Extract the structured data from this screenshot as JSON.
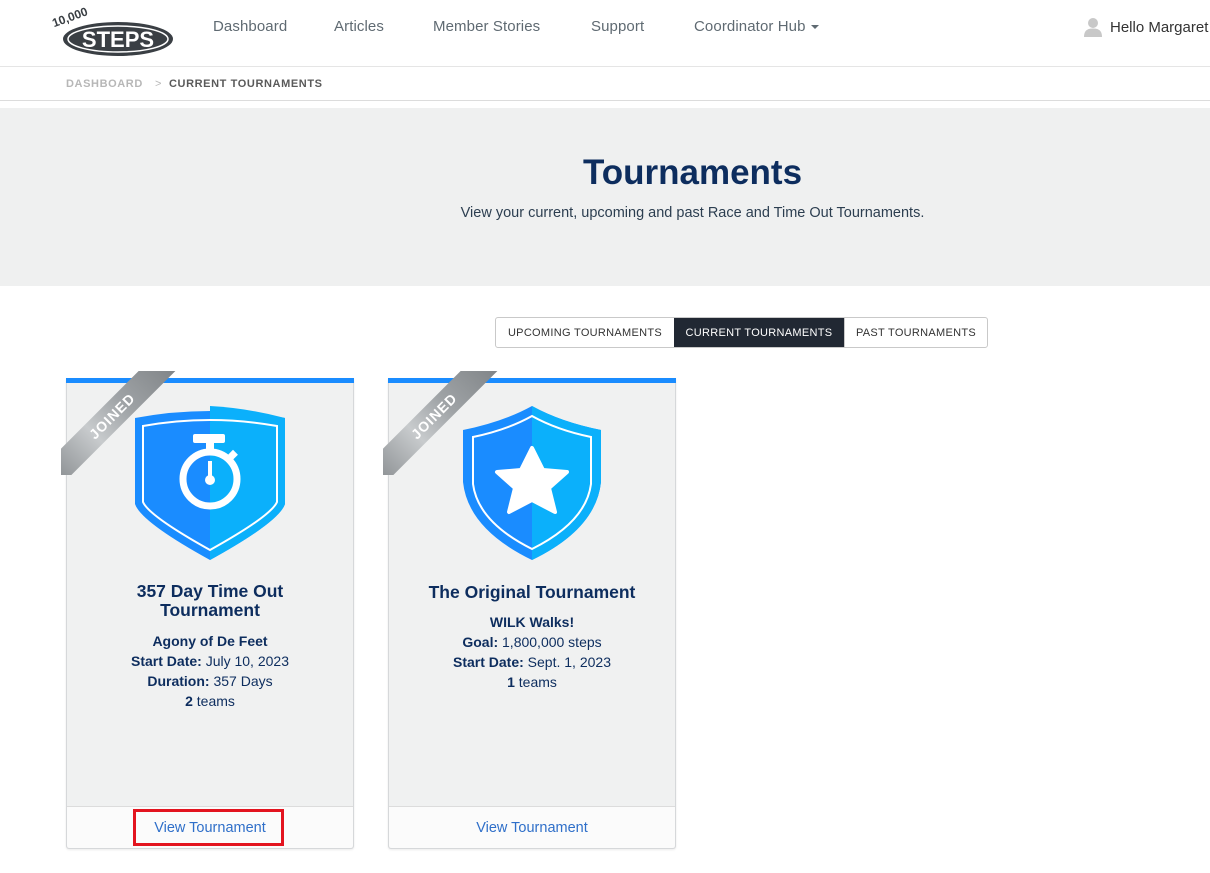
{
  "header": {
    "logo_alt": "10,000 Steps",
    "logo_top": "10,000",
    "logo_main": "STEPS",
    "nav": [
      {
        "label": "Dashboard"
      },
      {
        "label": "Articles"
      },
      {
        "label": "Member Stories"
      },
      {
        "label": "Support"
      },
      {
        "label": "Coordinator Hub",
        "has_dropdown": true
      }
    ],
    "user_greeting": "Hello Margaret",
    "user_icon": "user-icon"
  },
  "breadcrumb": {
    "items": [
      {
        "label": "DASHBOARD"
      },
      {
        "label": "CURRENT TOURNAMENTS"
      }
    ],
    "separator": ">"
  },
  "hero": {
    "title": "Tournaments",
    "subtitle": "View your current, upcoming and past Race and Time Out Tournaments."
  },
  "tabs": [
    {
      "label": "UPCOMING TOURNAMENTS",
      "active": false
    },
    {
      "label": "CURRENT TOURNAMENTS",
      "active": true
    },
    {
      "label": "PAST TOURNAMENTS",
      "active": false
    }
  ],
  "colors": {
    "accent": "#1a8cff",
    "navy": "#0d2d5e",
    "active_tab": "#212833",
    "link": "#2f6fc9",
    "highlight": "#e3141f"
  },
  "cards": [
    {
      "ribbon": "JOINED",
      "badge_icon": "stopwatch-shield-icon",
      "title": "357 Day Time Out Tournament",
      "team_name": "Agony of De Feet",
      "start_label": "Start Date:",
      "start_value": " July 10, 2023",
      "duration_label": "Duration:",
      "duration_value": " 357 Days",
      "teams_count": "2",
      "teams_suffix": " teams",
      "link": "View Tournament"
    },
    {
      "ribbon": "JOINED",
      "badge_icon": "star-shield-icon",
      "title": "The Original Tournament",
      "team_name": "WILK Walks!",
      "goal_label": "Goal:",
      "goal_value": " 1,800,000 steps",
      "start_label": "Start Date:",
      "start_value": " Sept. 1, 2023",
      "teams_count": "1",
      "teams_suffix": " teams",
      "link": "View Tournament"
    }
  ]
}
